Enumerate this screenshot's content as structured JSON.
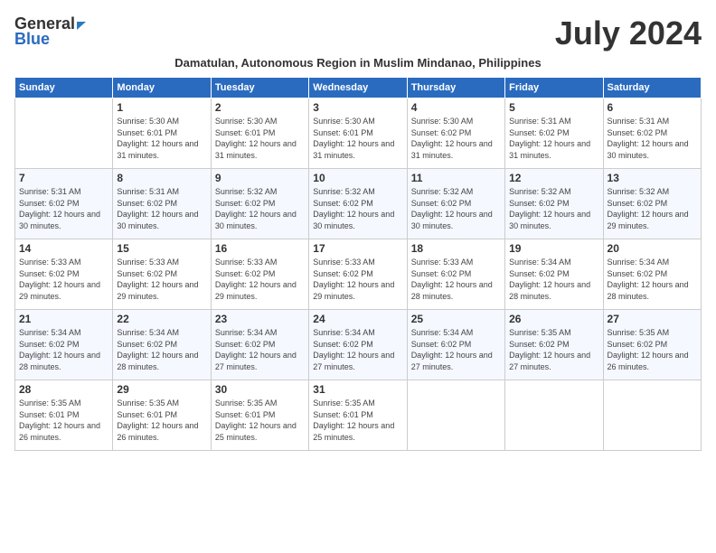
{
  "header": {
    "logo_general": "General",
    "logo_blue": "Blue",
    "month_year": "July 2024",
    "subtitle": "Damatulan, Autonomous Region in Muslim Mindanao, Philippines"
  },
  "days_of_week": [
    "Sunday",
    "Monday",
    "Tuesday",
    "Wednesday",
    "Thursday",
    "Friday",
    "Saturday"
  ],
  "weeks": [
    [
      {
        "day": "",
        "sunrise": "",
        "sunset": "",
        "daylight": ""
      },
      {
        "day": "1",
        "sunrise": "Sunrise: 5:30 AM",
        "sunset": "Sunset: 6:01 PM",
        "daylight": "Daylight: 12 hours and 31 minutes."
      },
      {
        "day": "2",
        "sunrise": "Sunrise: 5:30 AM",
        "sunset": "Sunset: 6:01 PM",
        "daylight": "Daylight: 12 hours and 31 minutes."
      },
      {
        "day": "3",
        "sunrise": "Sunrise: 5:30 AM",
        "sunset": "Sunset: 6:01 PM",
        "daylight": "Daylight: 12 hours and 31 minutes."
      },
      {
        "day": "4",
        "sunrise": "Sunrise: 5:30 AM",
        "sunset": "Sunset: 6:02 PM",
        "daylight": "Daylight: 12 hours and 31 minutes."
      },
      {
        "day": "5",
        "sunrise": "Sunrise: 5:31 AM",
        "sunset": "Sunset: 6:02 PM",
        "daylight": "Daylight: 12 hours and 31 minutes."
      },
      {
        "day": "6",
        "sunrise": "Sunrise: 5:31 AM",
        "sunset": "Sunset: 6:02 PM",
        "daylight": "Daylight: 12 hours and 30 minutes."
      }
    ],
    [
      {
        "day": "7",
        "sunrise": "Sunrise: 5:31 AM",
        "sunset": "Sunset: 6:02 PM",
        "daylight": "Daylight: 12 hours and 30 minutes."
      },
      {
        "day": "8",
        "sunrise": "Sunrise: 5:31 AM",
        "sunset": "Sunset: 6:02 PM",
        "daylight": "Daylight: 12 hours and 30 minutes."
      },
      {
        "day": "9",
        "sunrise": "Sunrise: 5:32 AM",
        "sunset": "Sunset: 6:02 PM",
        "daylight": "Daylight: 12 hours and 30 minutes."
      },
      {
        "day": "10",
        "sunrise": "Sunrise: 5:32 AM",
        "sunset": "Sunset: 6:02 PM",
        "daylight": "Daylight: 12 hours and 30 minutes."
      },
      {
        "day": "11",
        "sunrise": "Sunrise: 5:32 AM",
        "sunset": "Sunset: 6:02 PM",
        "daylight": "Daylight: 12 hours and 30 minutes."
      },
      {
        "day": "12",
        "sunrise": "Sunrise: 5:32 AM",
        "sunset": "Sunset: 6:02 PM",
        "daylight": "Daylight: 12 hours and 30 minutes."
      },
      {
        "day": "13",
        "sunrise": "Sunrise: 5:32 AM",
        "sunset": "Sunset: 6:02 PM",
        "daylight": "Daylight: 12 hours and 29 minutes."
      }
    ],
    [
      {
        "day": "14",
        "sunrise": "Sunrise: 5:33 AM",
        "sunset": "Sunset: 6:02 PM",
        "daylight": "Daylight: 12 hours and 29 minutes."
      },
      {
        "day": "15",
        "sunrise": "Sunrise: 5:33 AM",
        "sunset": "Sunset: 6:02 PM",
        "daylight": "Daylight: 12 hours and 29 minutes."
      },
      {
        "day": "16",
        "sunrise": "Sunrise: 5:33 AM",
        "sunset": "Sunset: 6:02 PM",
        "daylight": "Daylight: 12 hours and 29 minutes."
      },
      {
        "day": "17",
        "sunrise": "Sunrise: 5:33 AM",
        "sunset": "Sunset: 6:02 PM",
        "daylight": "Daylight: 12 hours and 29 minutes."
      },
      {
        "day": "18",
        "sunrise": "Sunrise: 5:33 AM",
        "sunset": "Sunset: 6:02 PM",
        "daylight": "Daylight: 12 hours and 28 minutes."
      },
      {
        "day": "19",
        "sunrise": "Sunrise: 5:34 AM",
        "sunset": "Sunset: 6:02 PM",
        "daylight": "Daylight: 12 hours and 28 minutes."
      },
      {
        "day": "20",
        "sunrise": "Sunrise: 5:34 AM",
        "sunset": "Sunset: 6:02 PM",
        "daylight": "Daylight: 12 hours and 28 minutes."
      }
    ],
    [
      {
        "day": "21",
        "sunrise": "Sunrise: 5:34 AM",
        "sunset": "Sunset: 6:02 PM",
        "daylight": "Daylight: 12 hours and 28 minutes."
      },
      {
        "day": "22",
        "sunrise": "Sunrise: 5:34 AM",
        "sunset": "Sunset: 6:02 PM",
        "daylight": "Daylight: 12 hours and 28 minutes."
      },
      {
        "day": "23",
        "sunrise": "Sunrise: 5:34 AM",
        "sunset": "Sunset: 6:02 PM",
        "daylight": "Daylight: 12 hours and 27 minutes."
      },
      {
        "day": "24",
        "sunrise": "Sunrise: 5:34 AM",
        "sunset": "Sunset: 6:02 PM",
        "daylight": "Daylight: 12 hours and 27 minutes."
      },
      {
        "day": "25",
        "sunrise": "Sunrise: 5:34 AM",
        "sunset": "Sunset: 6:02 PM",
        "daylight": "Daylight: 12 hours and 27 minutes."
      },
      {
        "day": "26",
        "sunrise": "Sunrise: 5:35 AM",
        "sunset": "Sunset: 6:02 PM",
        "daylight": "Daylight: 12 hours and 27 minutes."
      },
      {
        "day": "27",
        "sunrise": "Sunrise: 5:35 AM",
        "sunset": "Sunset: 6:02 PM",
        "daylight": "Daylight: 12 hours and 26 minutes."
      }
    ],
    [
      {
        "day": "28",
        "sunrise": "Sunrise: 5:35 AM",
        "sunset": "Sunset: 6:01 PM",
        "daylight": "Daylight: 12 hours and 26 minutes."
      },
      {
        "day": "29",
        "sunrise": "Sunrise: 5:35 AM",
        "sunset": "Sunset: 6:01 PM",
        "daylight": "Daylight: 12 hours and 26 minutes."
      },
      {
        "day": "30",
        "sunrise": "Sunrise: 5:35 AM",
        "sunset": "Sunset: 6:01 PM",
        "daylight": "Daylight: 12 hours and 25 minutes."
      },
      {
        "day": "31",
        "sunrise": "Sunrise: 5:35 AM",
        "sunset": "Sunset: 6:01 PM",
        "daylight": "Daylight: 12 hours and 25 minutes."
      },
      {
        "day": "",
        "sunrise": "",
        "sunset": "",
        "daylight": ""
      },
      {
        "day": "",
        "sunrise": "",
        "sunset": "",
        "daylight": ""
      },
      {
        "day": "",
        "sunrise": "",
        "sunset": "",
        "daylight": ""
      }
    ]
  ]
}
